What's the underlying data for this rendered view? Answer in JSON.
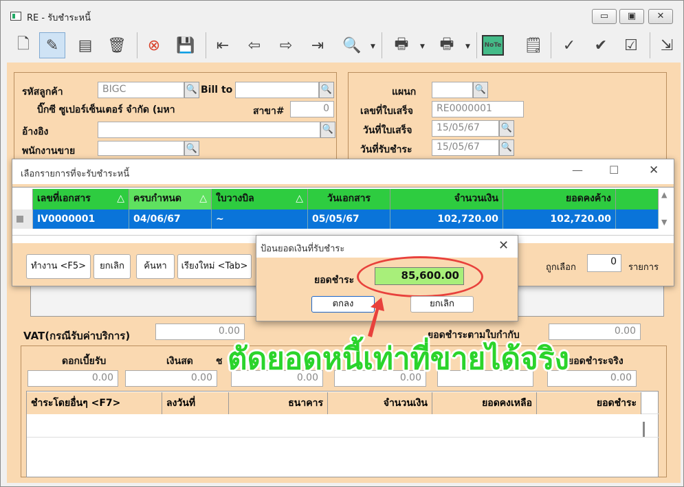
{
  "window": {
    "title": "RE - รับชำระหนี้",
    "min": "▭",
    "max": "▣",
    "close": "✕"
  },
  "toolbar": {
    "icons": [
      "new-icon",
      "edit-icon",
      "stamp-icon",
      "bin-icon",
      "cancel-icon",
      "save-icon",
      "first-icon",
      "prev-icon",
      "next-icon",
      "last-icon",
      "find-icon",
      "print-icon",
      "print-dd-icon",
      "note-icon",
      "receipt-icon",
      "ok-icon",
      "ok2-icon",
      "ok3-icon",
      "export-icon"
    ],
    "note": "NoTe"
  },
  "header": {
    "customer_code_label": "รหัสลูกค้า",
    "customer_code": "BIGC",
    "bill_to_label": "Bill to",
    "bill_to": "",
    "customer_name": "บิ๊กซี ซูเปอร์เซ็นเตอร์ จำกัด (มหา",
    "branch_label": "สาขา#",
    "branch": "0",
    "reference_label": "อ้างอิง",
    "reference": "",
    "salesperson_label": "พนักงานขาย",
    "salesperson": "",
    "department_label": "แผนก",
    "department": "",
    "receipt_no_label": "เลขที่ใบเสร็จ",
    "receipt_no": "RE0000001",
    "receipt_date_label": "วันที่ใบเสร็จ",
    "receipt_date": "15/05/67",
    "pay_date_label": "วันที่รับชำระ",
    "pay_date": "15/05/67"
  },
  "select_dialog": {
    "title": "เลือกรายการที่จะรับชำระหนี้",
    "columns": [
      "เลขที่เอกสาร",
      "ครบกำหนด",
      "ใบวางบิล",
      "วันเอกสาร",
      "จำนวนเงิน",
      "ยอดคงค้าง"
    ],
    "row": {
      "doc": "IV0000001",
      "due": "04/06/67",
      "bill": "~",
      "date": "05/05/67",
      "amount": "102,720.00",
      "balance": "102,720.00"
    },
    "buttons": {
      "run": "ทำงาน <F5>",
      "cancel": "ยกเลิก",
      "search": "ค้นหา",
      "resort": "เรียงใหม่ <Tab>"
    },
    "selected_label": "ถูกเลือก",
    "selected_count": "0",
    "items_label": "รายการ"
  },
  "amount_popup": {
    "title": "ป้อนยอดเงินที่รับชำระ",
    "amount_label": "ยอดชำระ",
    "amount": "85,600.00",
    "ok": "ตกลง",
    "cancel": "ยกเลิก"
  },
  "lower": {
    "vat_label": "VAT(กรณีรับค่าบริการ)",
    "vat": "0.00",
    "tax_label": "ยอดชำระตามใบกำกับ",
    "tax": "0.00",
    "interest_label": "ดอกเบี้ยรับ",
    "interest": "0.00",
    "cash_label": "เงินสด",
    "cash": "0.00",
    "cheque_label": "ช",
    "cheque": "0.00",
    "f3": "0.00",
    "f4": "",
    "actual_label": "ยอดชำระจริง",
    "actual": "0.00",
    "table_columns": [
      "ชำระโดยอื่นๆ <F7>",
      "ลงวันที่",
      "ธนาคาร",
      "จำนวนเงิน",
      "ยอดคงเหลือ",
      "ยอดชำระ"
    ]
  },
  "caption": "ตัดยอดหนี้เท่าที่ขายได้จริง",
  "colors": {
    "panel": "#fad9b1",
    "header_green": "#2ecc40",
    "selected_row": "#0a74d9",
    "amount_field": "#a8ef7a",
    "highlight_ring": "#e8413c",
    "caption_green": "#2bd42b"
  }
}
